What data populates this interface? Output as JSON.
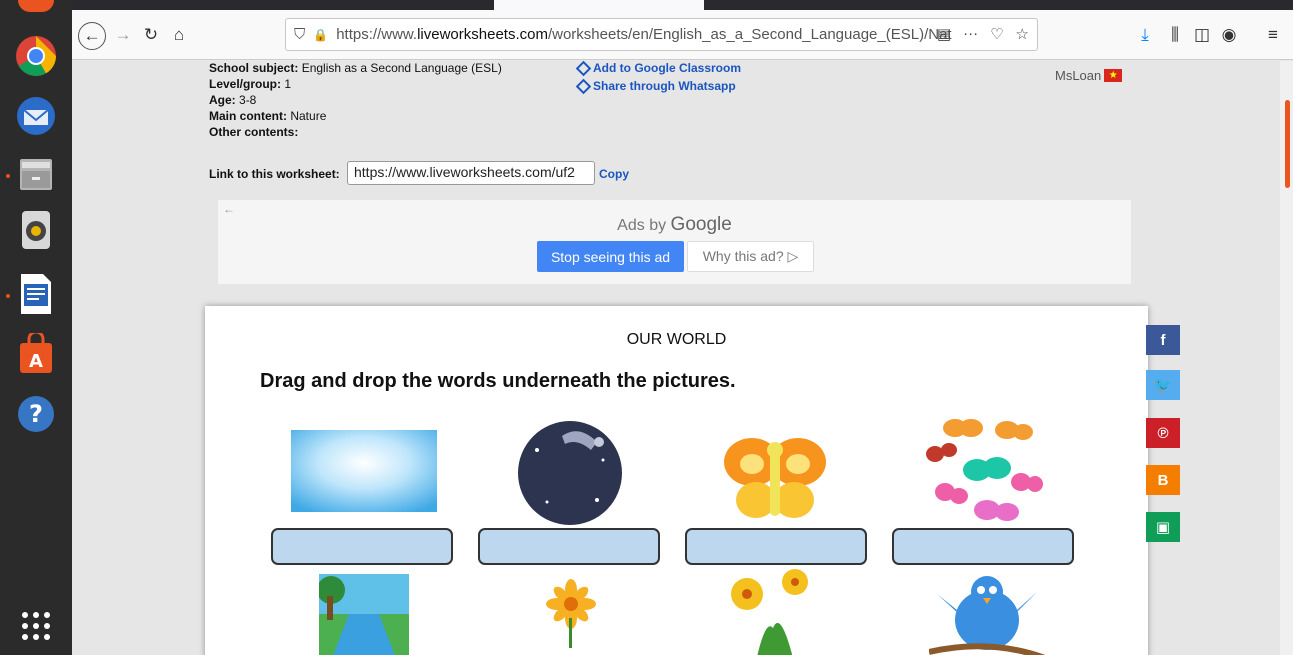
{
  "browser": {
    "url_prefix": "https://www.",
    "url_domain": "liveworksheets.com",
    "url_rest": "/worksheets/en/English_as_a_Second_Language_(ESL)/Nat"
  },
  "meta": {
    "subject_label": "School subject:",
    "subject_value": "English as a Second Language (ESL)",
    "level_label": "Level/group:",
    "level_value": "1",
    "age_label": "Age:",
    "age_value": "3-8",
    "content_label": "Main content:",
    "content_value": "Nature",
    "other_label": "Other contents:",
    "other_value": ""
  },
  "actions": {
    "classroom": "Add to Google Classroom",
    "whatsapp": "Share through Whatsapp"
  },
  "author": "MsLoan",
  "link": {
    "label": "Link to this worksheet:",
    "value": "https://www.liveworksheets.com/uf2",
    "copy": "Copy"
  },
  "ad": {
    "ads_by": "Ads by",
    "google": "Google",
    "stop": "Stop seeing this ad",
    "why": "Why this ad? ▷"
  },
  "worksheet": {
    "title": "OUR WORLD",
    "instruction": "Drag and drop the words underneath the pictures."
  },
  "colors": {
    "accent": "#e95420",
    "link": "#1a55c0",
    "dropbox": "#bdd7ee",
    "facebook": "#3b5998",
    "twitter": "#55acee",
    "pinterest": "#cb2027",
    "blogger": "#f57d00",
    "classroom": "#0f9d58"
  }
}
